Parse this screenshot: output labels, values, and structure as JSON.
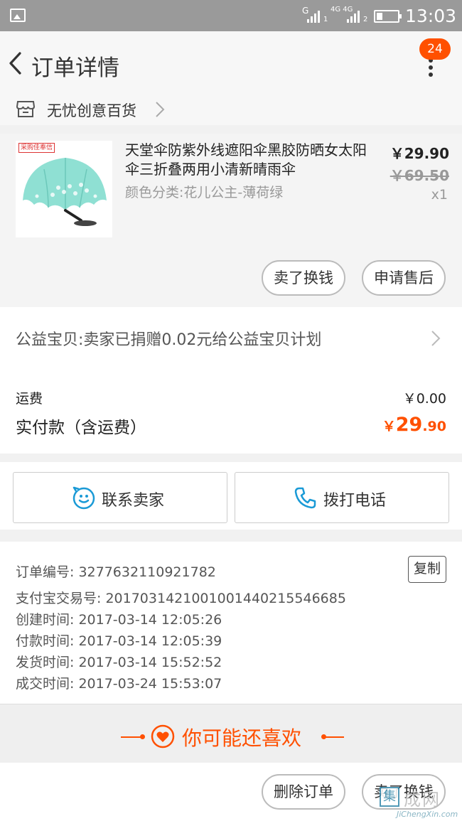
{
  "status_bar": {
    "sim1_label": "G",
    "sim1_index": "1",
    "sim2_label": "4G 4G",
    "sim2_index": "2",
    "time": "13:03"
  },
  "header": {
    "title": "订单详情",
    "badge_count": "24"
  },
  "shop": {
    "name": "无忧创意百货"
  },
  "item": {
    "title": "天堂伞防紫外线遮阳伞黑胶防晒女太阳伞三折叠两用小清新晴雨伞",
    "sku": "颜色分类:花儿公主-薄荷绿",
    "price": "￥29.90",
    "original_price": "￥69.50",
    "quantity": "x1",
    "image_tag": "采购佳奉信"
  },
  "item_actions": {
    "sell_label": "卖了换钱",
    "after_sale_label": "申请售后"
  },
  "charity": {
    "text": "公益宝贝:卖家已捐赠0.02元给公益宝贝计划"
  },
  "fees": {
    "shipping_label": "运费",
    "shipping_value": "￥0.00",
    "paid_label": "实付款（含运费）",
    "paid_currency": "￥",
    "paid_integer": "29",
    "paid_decimal": ".90"
  },
  "contact": {
    "seller_label": "联系卖家",
    "call_label": "拨打电话"
  },
  "order_info": {
    "copy_label": "复制",
    "lines": [
      {
        "key": "订单编号:",
        "value": "3277632110921782"
      },
      {
        "key": "支付宝交易号:",
        "value": "2017031421001001440215546685"
      },
      {
        "key": "创建时间:",
        "value": "2017-03-14 12:05:26"
      },
      {
        "key": "付款时间:",
        "value": "2017-03-14 12:05:39"
      },
      {
        "key": "发货时间:",
        "value": "2017-03-14 15:52:52"
      },
      {
        "key": "成交时间:",
        "value": "2017-03-24 15:53:07"
      }
    ]
  },
  "recommend": {
    "title": "你可能还喜欢"
  },
  "bottom_bar": {
    "delete_label": "删除订单",
    "sell_label": "卖了换钱"
  },
  "watermark": {
    "char": "集",
    "text": "成网",
    "sub": "JiChengXin.com"
  },
  "colors": {
    "accent": "#ff5000",
    "status_bar": "#9a9a9a",
    "contact_icon": "#1a9ad6"
  },
  "icons": [
    "gallery-icon",
    "signal-icon",
    "battery-icon",
    "back-icon",
    "more-icon",
    "store-icon",
    "chevron-right-icon",
    "smile-chat-icon",
    "phone-icon",
    "heart-icon"
  ]
}
